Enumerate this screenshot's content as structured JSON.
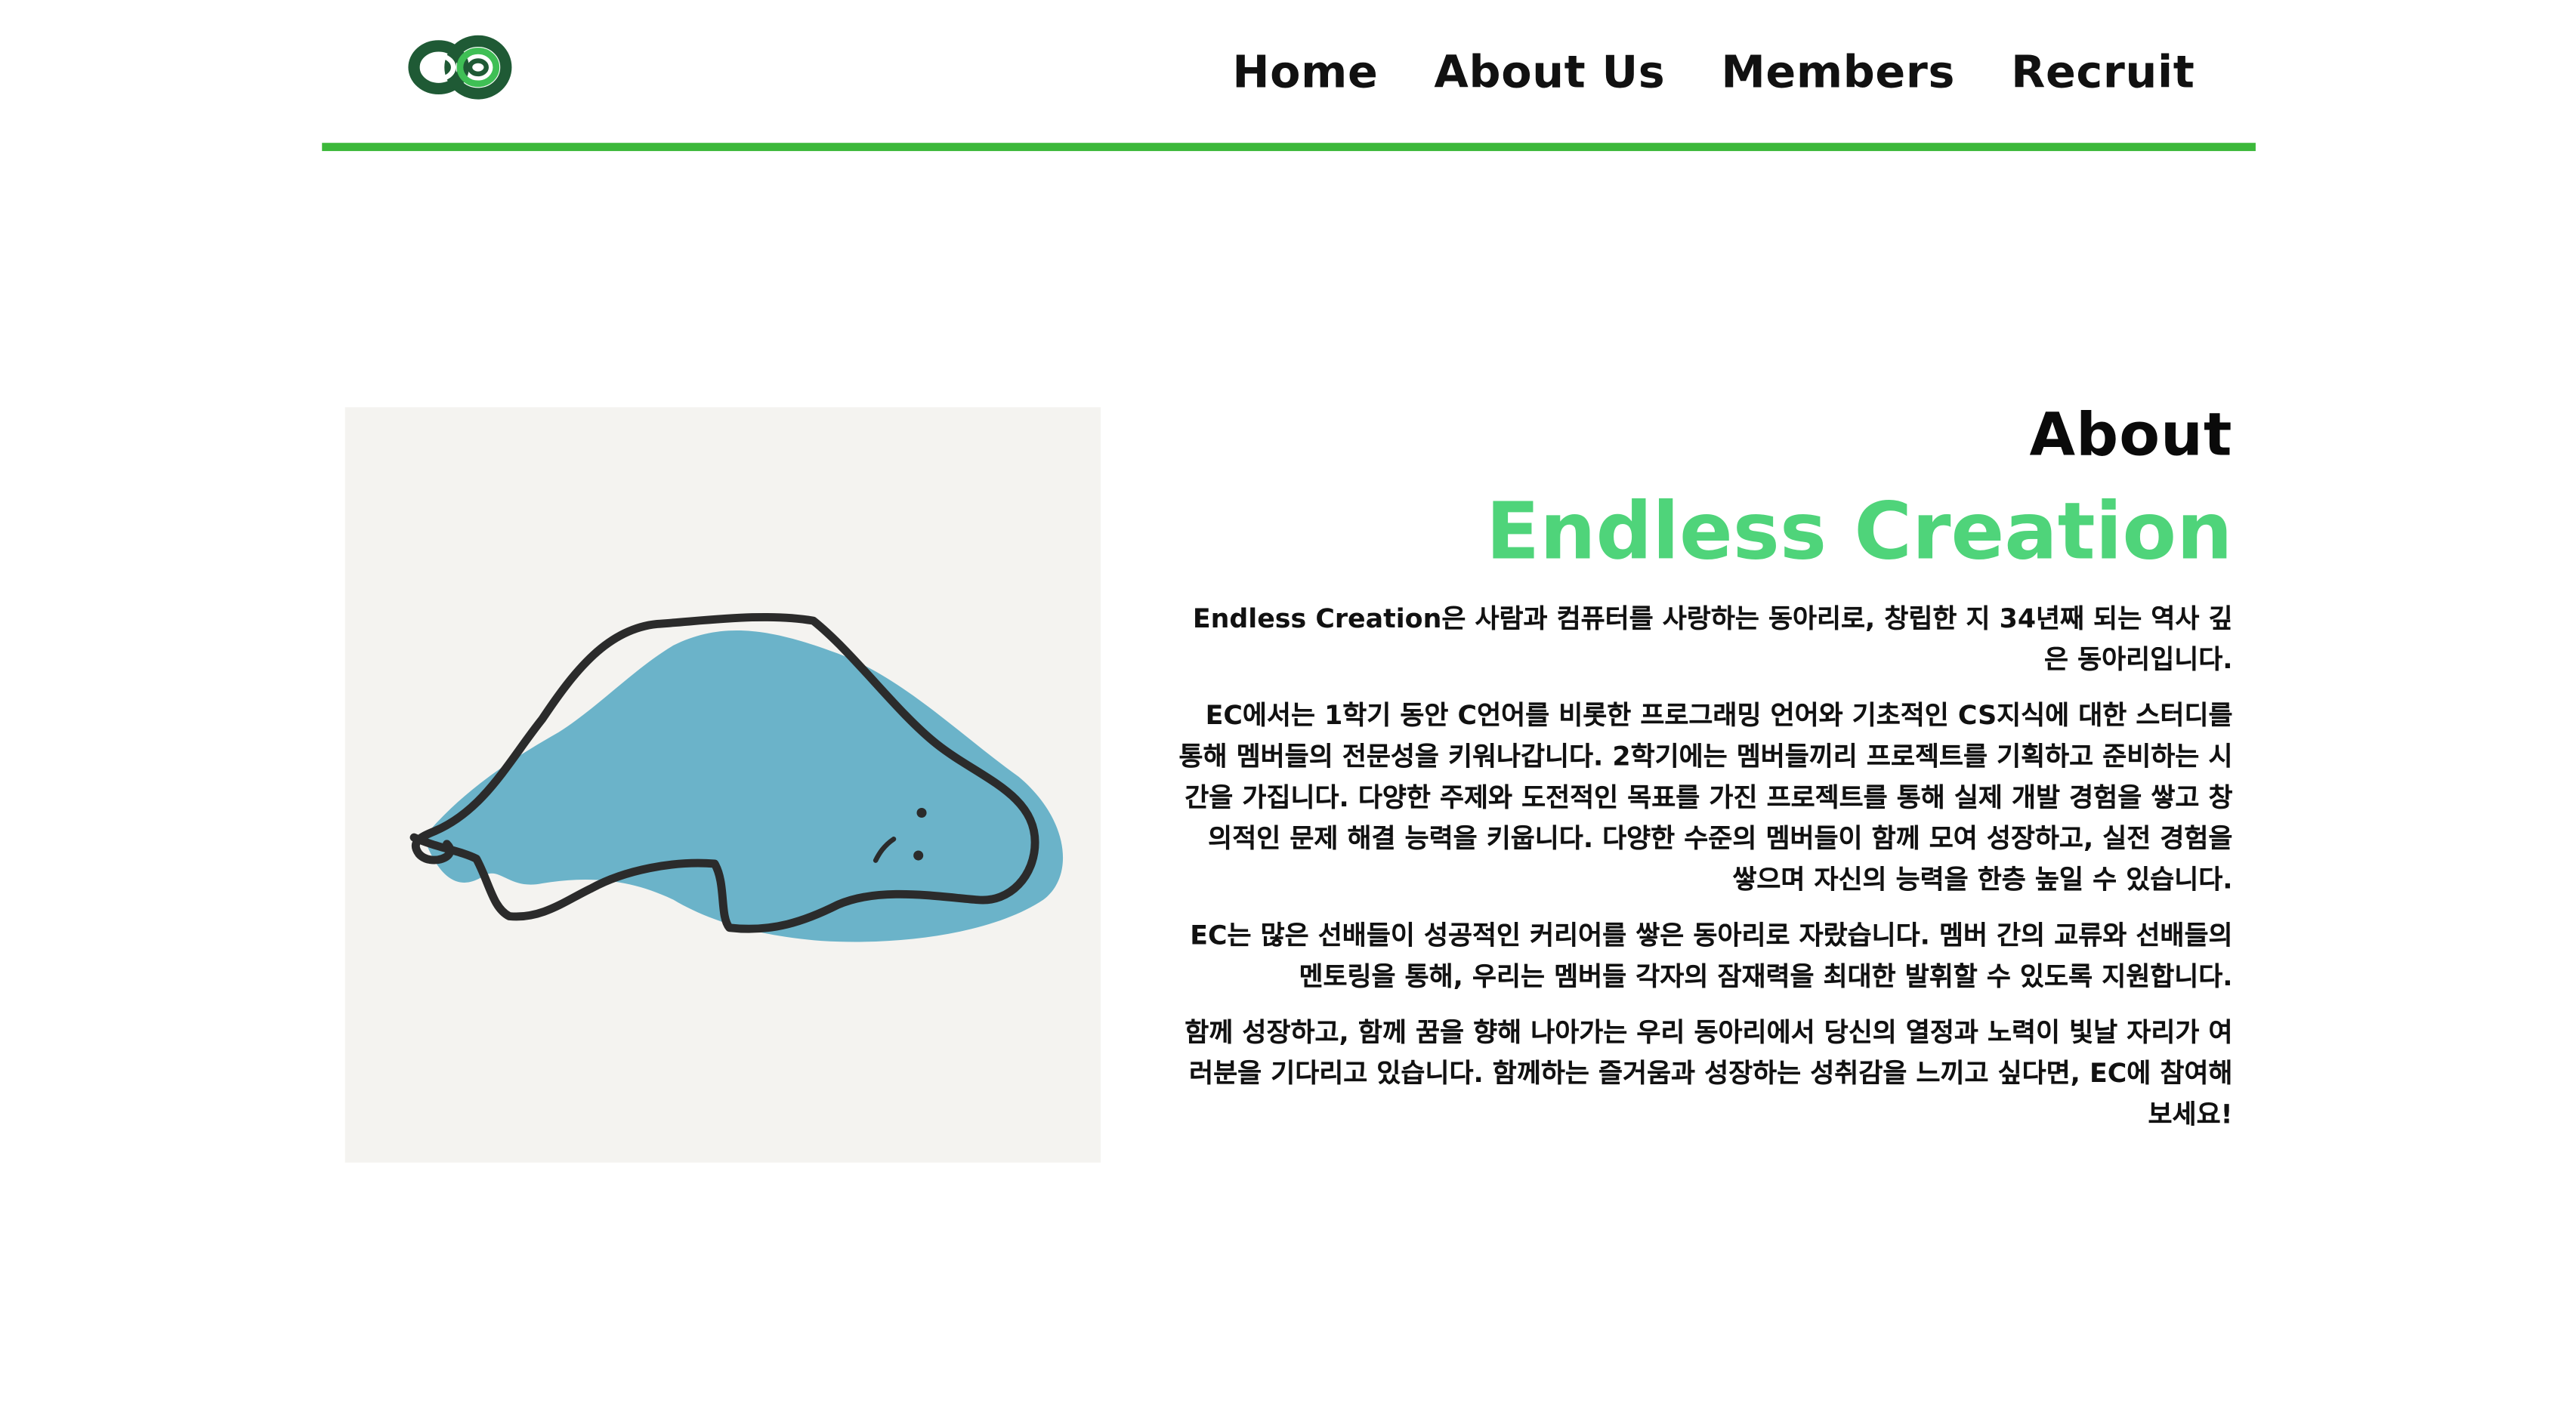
{
  "header": {
    "logo_icon": "infinity-logo-icon",
    "nav": [
      {
        "label": "Home"
      },
      {
        "label": "About Us"
      },
      {
        "label": "Members"
      },
      {
        "label": "Recruit"
      }
    ],
    "accent_color": "#3cb83a"
  },
  "main": {
    "illustration_icon": "blue-blob-doodle-illustration",
    "kicker": "About",
    "title": "Endless Creation",
    "title_color": "#4fd47a",
    "paragraphs": [
      "Endless Creation은 사람과 컴퓨터를 사랑하는 동아리로, 창립한 지 34년째 되는 역사 깊은 동아리입니다.",
      "EC에서는 1학기 동안 C언어를 비롯한 프로그래밍 언어와 기초적인 CS지식에 대한 스터디를 통해 멤버들의 전문성을 키워나갑니다. 2학기에는 멤버들끼리 프로젝트를 기획하고 준비하는 시간을 가집니다. 다양한 주제와 도전적인 목표를 가진 프로젝트를 통해 실제 개발 경험을 쌓고 창의적인 문제 해결 능력을 키웁니다. 다양한 수준의 멤버들이 함께 모여 성장하고, 실전 경험을 쌓으며 자신의 능력을 한층 높일 수 있습니다.",
      "EC는 많은 선배들이 성공적인 커리어를 쌓은 동아리로 자랐습니다. 멤버 간의 교류와 선배들의 멘토링을 통해, 우리는 멤버들 각자의 잠재력을 최대한 발휘할 수 있도록 지원합니다.",
      "함께 성장하고, 함께 꿈을 향해 나아가는 우리 동아리에서 당신의 열정과 노력이 빛날 자리가 여러분을 기다리고 있습니다. 함께하는 즐거움과 성장하는 성취감을 느끼고 싶다면, EC에 참여해보세요!"
    ]
  }
}
